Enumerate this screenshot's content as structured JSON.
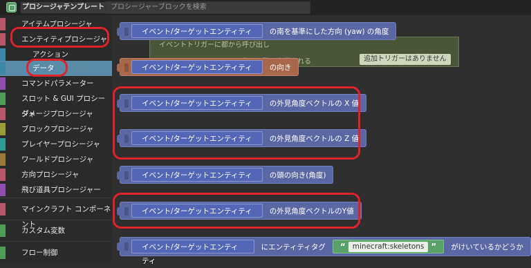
{
  "header": {
    "template_title": "プロシージャテンプレート",
    "search_placeholder": "プロシージャーブロックを検索"
  },
  "sidebar": {
    "items": [
      {
        "label": "アイテムプロシージャ",
        "color": "#b8566a"
      },
      {
        "label": "エンティティプロシージャ",
        "color": "#b8566a"
      },
      {
        "label": "アクション",
        "color": "#3d87a8"
      },
      {
        "label": "データ",
        "color": "#3d87a8"
      },
      {
        "label": "コマンドパラメーター",
        "color": "#8e4fae"
      },
      {
        "label": "スロット & GUI プロシージャ",
        "color": "#4e9e5a"
      },
      {
        "label": "ダメージプロシージャ",
        "color": "#b8566a"
      },
      {
        "label": "ブロックプロシージャ",
        "color": "#9a9b3a"
      },
      {
        "label": "プレイヤープロシージャ",
        "color": "#2f9c96"
      },
      {
        "label": "ワールドプロシージャ",
        "color": "#9a7a3a"
      },
      {
        "label": "方向プロシージャ",
        "color": "#b8566a"
      },
      {
        "label": "飛び道具プロシージャー",
        "color": "#8e4fae"
      },
      {
        "label": "マインクラフト コンポーネント",
        "color": "#b8566a"
      },
      {
        "label": "カスタム変数",
        "color": "#4e9e5a"
      },
      {
        "label": "フロー制御",
        "color": "#4e9e5a"
      }
    ]
  },
  "ghost": {
    "line1": "イベントトリガーに都から呼び出し",
    "line2": "生した際に実行される",
    "badge": "追加トリガーはありません"
  },
  "blocks": [
    {
      "inner": "イベント/ターゲットエンティティ",
      "tail": "の南を基準にした方向 (yaw) の角度"
    },
    {
      "inner": "イベント/ターゲットエンティティ",
      "tail": "の向き"
    },
    {
      "inner": "イベント/ターゲットエンティティ",
      "tail": "の外見角度ベクトルの X 値"
    },
    {
      "inner": "イベント/ターゲットエンティティ",
      "tail": "の外見角度ベクトルの Z 値"
    },
    {
      "inner": "イベント/ターゲットエンティティ",
      "tail": "の頭の向き(角度)"
    },
    {
      "inner": "イベント/ターゲットエンティティ",
      "tail": "の外見角度ベクトルのY値"
    },
    {
      "inner": "イベント/ターゲットエンティティ",
      "tail": "にエンティティタグ",
      "open_quote": "“",
      "string": "minecraft:skeletons",
      "close_quote": "”",
      "tail2": "がけいているかどうか"
    }
  ],
  "colors": {
    "highlight_ring": "#e0222a",
    "selected_category": "#5a8ba8",
    "block_blue": "#5b67a5",
    "block_orange": "#a9674a"
  }
}
